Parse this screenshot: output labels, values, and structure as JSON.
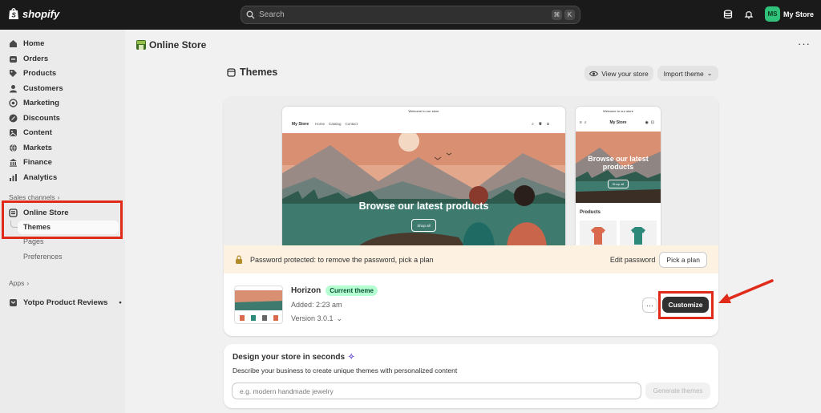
{
  "topbar": {
    "brand": "shopify",
    "search_placeholder": "Search",
    "shortcut_cmd": "⌘",
    "shortcut_key": "K",
    "store_initials": "MS",
    "store_name": "My Store"
  },
  "sidebar": {
    "items": [
      {
        "label": "Home",
        "icon": "home-icon"
      },
      {
        "label": "Orders",
        "icon": "orders-icon"
      },
      {
        "label": "Products",
        "icon": "tag-icon"
      },
      {
        "label": "Customers",
        "icon": "person-icon"
      },
      {
        "label": "Marketing",
        "icon": "target-icon"
      },
      {
        "label": "Discounts",
        "icon": "discount-icon"
      },
      {
        "label": "Content",
        "icon": "content-icon"
      },
      {
        "label": "Markets",
        "icon": "globe-icon"
      },
      {
        "label": "Finance",
        "icon": "bank-icon"
      },
      {
        "label": "Analytics",
        "icon": "chart-icon"
      }
    ],
    "sales_channels": "Sales channels",
    "online_store": "Online Store",
    "sub": [
      "Themes",
      "Pages",
      "Preferences"
    ],
    "apps": "Apps",
    "app_item": "Yotpo Product Reviews"
  },
  "page": {
    "header_title": "Online Store",
    "title": "Themes",
    "view_store": "View your store",
    "import_theme": "Import theme"
  },
  "preview": {
    "welcome": "Welcome to our store",
    "store": "My Store",
    "nav": [
      "Home",
      "Catalog",
      "Contact"
    ],
    "hero": "Browse our latest products",
    "shop_all": "Shop all",
    "mobile_hero": "Browse our latest products",
    "products": "Products"
  },
  "password": {
    "text": "Password protected: to remove the password, pick a plan",
    "edit": "Edit password",
    "pick": "Pick a plan"
  },
  "theme": {
    "name": "Horizon",
    "badge": "Current theme",
    "added": "Added: 2:23 am",
    "version": "Version 3.0.1",
    "customize": "Customize"
  },
  "design": {
    "title": "Design your store in seconds",
    "desc": "Describe your business to create unique themes with personalized content",
    "placeholder": "e.g. modern handmade jewelry",
    "button": "Generate themes"
  },
  "colors": {
    "accent_red": "#e02b1a",
    "badge_green": "#b4fed2",
    "avatar_green": "#30c27b",
    "dark": "#1a1a1a"
  }
}
